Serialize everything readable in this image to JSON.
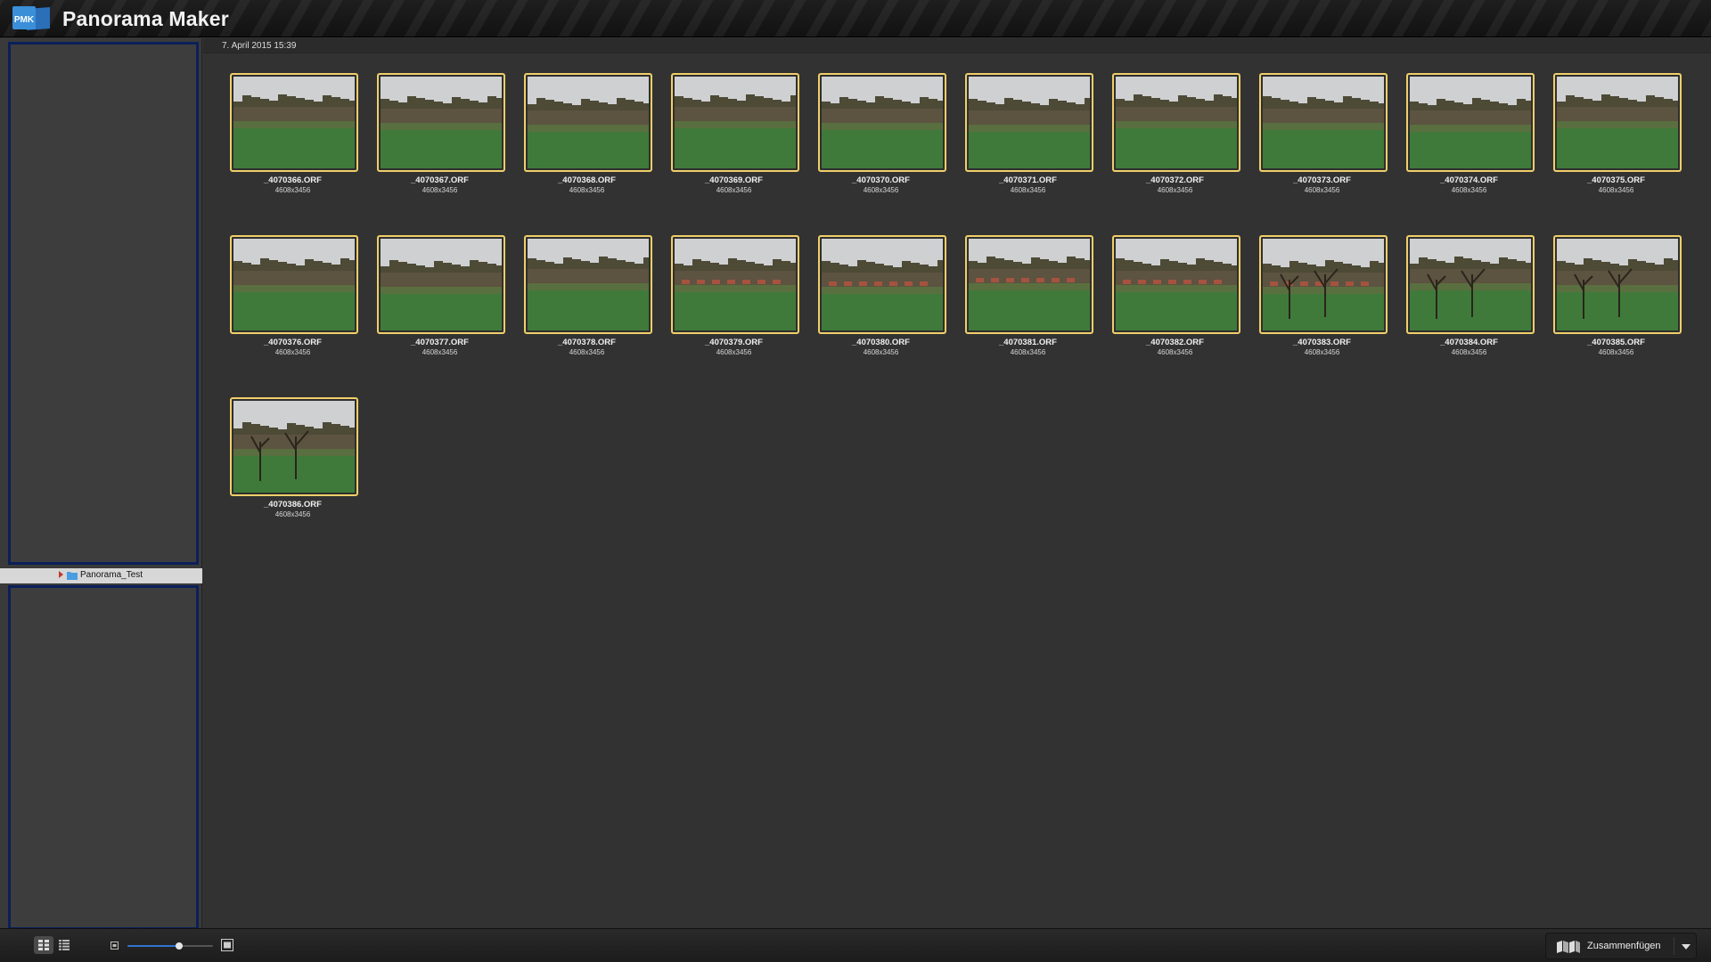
{
  "app": {
    "title": "Panorama Maker",
    "logo_text": "PMK"
  },
  "sidebar": {
    "folder": {
      "name": "Panorama_Test"
    }
  },
  "main": {
    "date_header": "7. April 2015 15:39",
    "thumbnails": [
      {
        "filename": "_4070366.ORF",
        "dimensions": "4608x3456"
      },
      {
        "filename": "_4070367.ORF",
        "dimensions": "4608x3456"
      },
      {
        "filename": "_4070368.ORF",
        "dimensions": "4608x3456"
      },
      {
        "filename": "_4070369.ORF",
        "dimensions": "4608x3456"
      },
      {
        "filename": "_4070370.ORF",
        "dimensions": "4608x3456"
      },
      {
        "filename": "_4070371.ORF",
        "dimensions": "4608x3456"
      },
      {
        "filename": "_4070372.ORF",
        "dimensions": "4608x3456"
      },
      {
        "filename": "_4070373.ORF",
        "dimensions": "4608x3456"
      },
      {
        "filename": "_4070374.ORF",
        "dimensions": "4608x3456"
      },
      {
        "filename": "_4070375.ORF",
        "dimensions": "4608x3456"
      },
      {
        "filename": "_4070376.ORF",
        "dimensions": "4608x3456"
      },
      {
        "filename": "_4070377.ORF",
        "dimensions": "4608x3456"
      },
      {
        "filename": "_4070378.ORF",
        "dimensions": "4608x3456"
      },
      {
        "filename": "_4070379.ORF",
        "dimensions": "4608x3456"
      },
      {
        "filename": "_4070380.ORF",
        "dimensions": "4608x3456"
      },
      {
        "filename": "_4070381.ORF",
        "dimensions": "4608x3456"
      },
      {
        "filename": "_4070382.ORF",
        "dimensions": "4608x3456"
      },
      {
        "filename": "_4070383.ORF",
        "dimensions": "4608x3456"
      },
      {
        "filename": "_4070384.ORF",
        "dimensions": "4608x3456"
      },
      {
        "filename": "_4070385.ORF",
        "dimensions": "4608x3456"
      },
      {
        "filename": "_4070386.ORF",
        "dimensions": "4608x3456"
      }
    ]
  },
  "toolbar": {
    "zoom_level": 0.6,
    "merge_label": "Zusammenfügen",
    "selection_border_color": "#f0cf6a",
    "accent_color": "#2f74d0"
  }
}
